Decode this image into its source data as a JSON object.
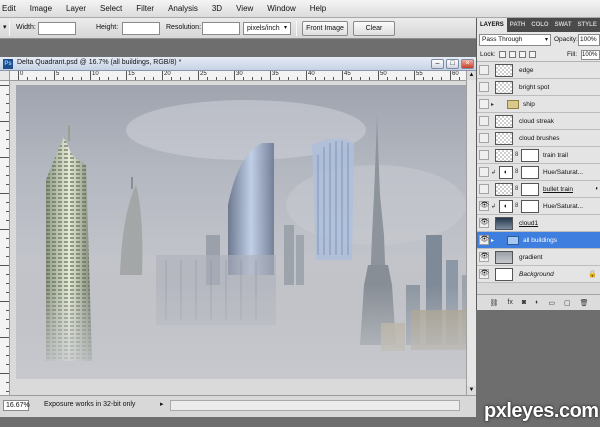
{
  "menu": [
    "Edit",
    "Image",
    "Layer",
    "Select",
    "Filter",
    "Analysis",
    "3D",
    "View",
    "Window",
    "Help"
  ],
  "options": {
    "width_label": "Width:",
    "height_label": "Height:",
    "resolution_label": "Resolution:",
    "units": "pixels/inch",
    "front_image": "Front Image",
    "clear": "Clear"
  },
  "document": {
    "title": "Delta Quadrant.psd @ 16.7% (all buildings, RGB/8) *",
    "ruler_numbers": [
      "0",
      "5",
      "10",
      "15",
      "20",
      "25",
      "30",
      "35",
      "40",
      "45",
      "50",
      "55",
      "60"
    ],
    "zoom": "16.67%",
    "status_message": "Exposure works in 32-bit only"
  },
  "layers_panel": {
    "tabs": [
      "LAYERS",
      "PATH",
      "COLO",
      "SWAT",
      "STYLE"
    ],
    "blend_mode": "Pass Through",
    "opacity_label": "Opacity:",
    "opacity": "100%",
    "lock_label": "Lock:",
    "fill_label": "Fill:",
    "fill": "100%",
    "layers": [
      {
        "name": "edge",
        "visible": false,
        "type": "pixel"
      },
      {
        "name": "bright spot",
        "visible": false,
        "type": "pixel"
      },
      {
        "name": "ship",
        "visible": false,
        "type": "group"
      },
      {
        "name": "cloud streak",
        "visible": false,
        "type": "pixel"
      },
      {
        "name": "cloud brushes",
        "visible": false,
        "type": "pixel"
      },
      {
        "name": "train trail",
        "visible": false,
        "type": "masked"
      },
      {
        "name": "Hue/Saturat...",
        "visible": false,
        "type": "adjustment"
      },
      {
        "name": "bullet train",
        "visible": false,
        "type": "masked"
      },
      {
        "name": "Hue/Saturat...",
        "visible": true,
        "type": "adjustment"
      },
      {
        "name": "cloud1",
        "visible": true,
        "type": "image"
      },
      {
        "name": "all buildings",
        "visible": true,
        "type": "group",
        "selected": true
      },
      {
        "name": "gradient",
        "visible": true,
        "type": "gray"
      },
      {
        "name": "Background",
        "visible": true,
        "type": "background"
      }
    ]
  },
  "watermark": "pxleyes.com"
}
